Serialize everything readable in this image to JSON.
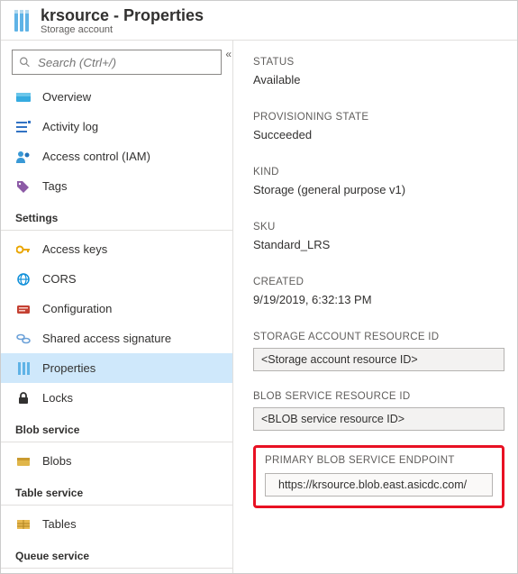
{
  "header": {
    "title": "krsource - Properties",
    "subtitle": "Storage account"
  },
  "search": {
    "placeholder": "Search (Ctrl+/)"
  },
  "nav": {
    "items": [
      {
        "label": "Overview"
      },
      {
        "label": "Activity log"
      },
      {
        "label": "Access control (IAM)"
      },
      {
        "label": "Tags"
      }
    ],
    "sections": [
      {
        "name": "Settings",
        "items": [
          {
            "label": "Access keys"
          },
          {
            "label": "CORS"
          },
          {
            "label": "Configuration"
          },
          {
            "label": "Shared access signature"
          },
          {
            "label": "Properties"
          },
          {
            "label": "Locks"
          }
        ]
      },
      {
        "name": "Blob service",
        "items": [
          {
            "label": "Blobs"
          }
        ]
      },
      {
        "name": "Table service",
        "items": [
          {
            "label": "Tables"
          }
        ]
      },
      {
        "name": "Queue service",
        "items": []
      }
    ]
  },
  "props": {
    "status_label": "STATUS",
    "status_value": "Available",
    "provisioning_label": "PROVISIONING STATE",
    "provisioning_value": "Succeeded",
    "kind_label": "KIND",
    "kind_value": "Storage (general purpose v1)",
    "sku_label": "SKU",
    "sku_value": "Standard_LRS",
    "created_label": "CREATED",
    "created_value": "9/19/2019, 6:32:13 PM",
    "resourceid_label": "STORAGE ACCOUNT RESOURCE ID",
    "resourceid_value": "<Storage account resource ID>",
    "blobresid_label": "BLOB SERVICE RESOURCE ID",
    "blobresid_value": "<BLOB service resource ID>",
    "endpoint_label": "PRIMARY BLOB SERVICE ENDPOINT",
    "endpoint_value": "https://krsource.blob.east.asicdc.com/"
  }
}
